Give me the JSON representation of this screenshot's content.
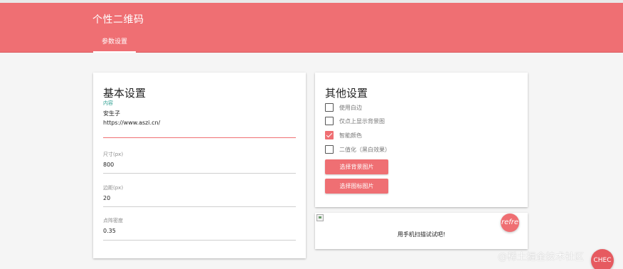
{
  "app": {
    "title": "个性二维码"
  },
  "tabs": [
    {
      "label": "参数设置",
      "active": true
    }
  ],
  "basic": {
    "title": "基本设置",
    "content_label": "内容",
    "content_lines": [
      "安生子",
      "https://www.aszi.cn/"
    ],
    "size_label": "尺寸(px)",
    "size_value": "800",
    "margin_label": "边距(px)",
    "margin_value": "20",
    "dot_label": "点阵密度",
    "dot_value": "0.35"
  },
  "other": {
    "title": "其他设置",
    "options": [
      {
        "label": "使用白边",
        "checked": false
      },
      {
        "label": "仅点上显示背景图",
        "checked": false
      },
      {
        "label": "智能颜色",
        "checked": true
      },
      {
        "label": "二值化（黑白效果）",
        "checked": false
      }
    ],
    "choose_bg_label": "选择背景图片",
    "choose_logo_label": "选择图标图片"
  },
  "preview": {
    "refresh_label": "refre",
    "caption": "用手机扫描试试吧!"
  },
  "overlay": {
    "watermark": "@稀土掘金技术社区",
    "check_label": "CHEC"
  },
  "colors": {
    "accent": "#ef6f73",
    "focus_label": "#2a9d8f"
  }
}
